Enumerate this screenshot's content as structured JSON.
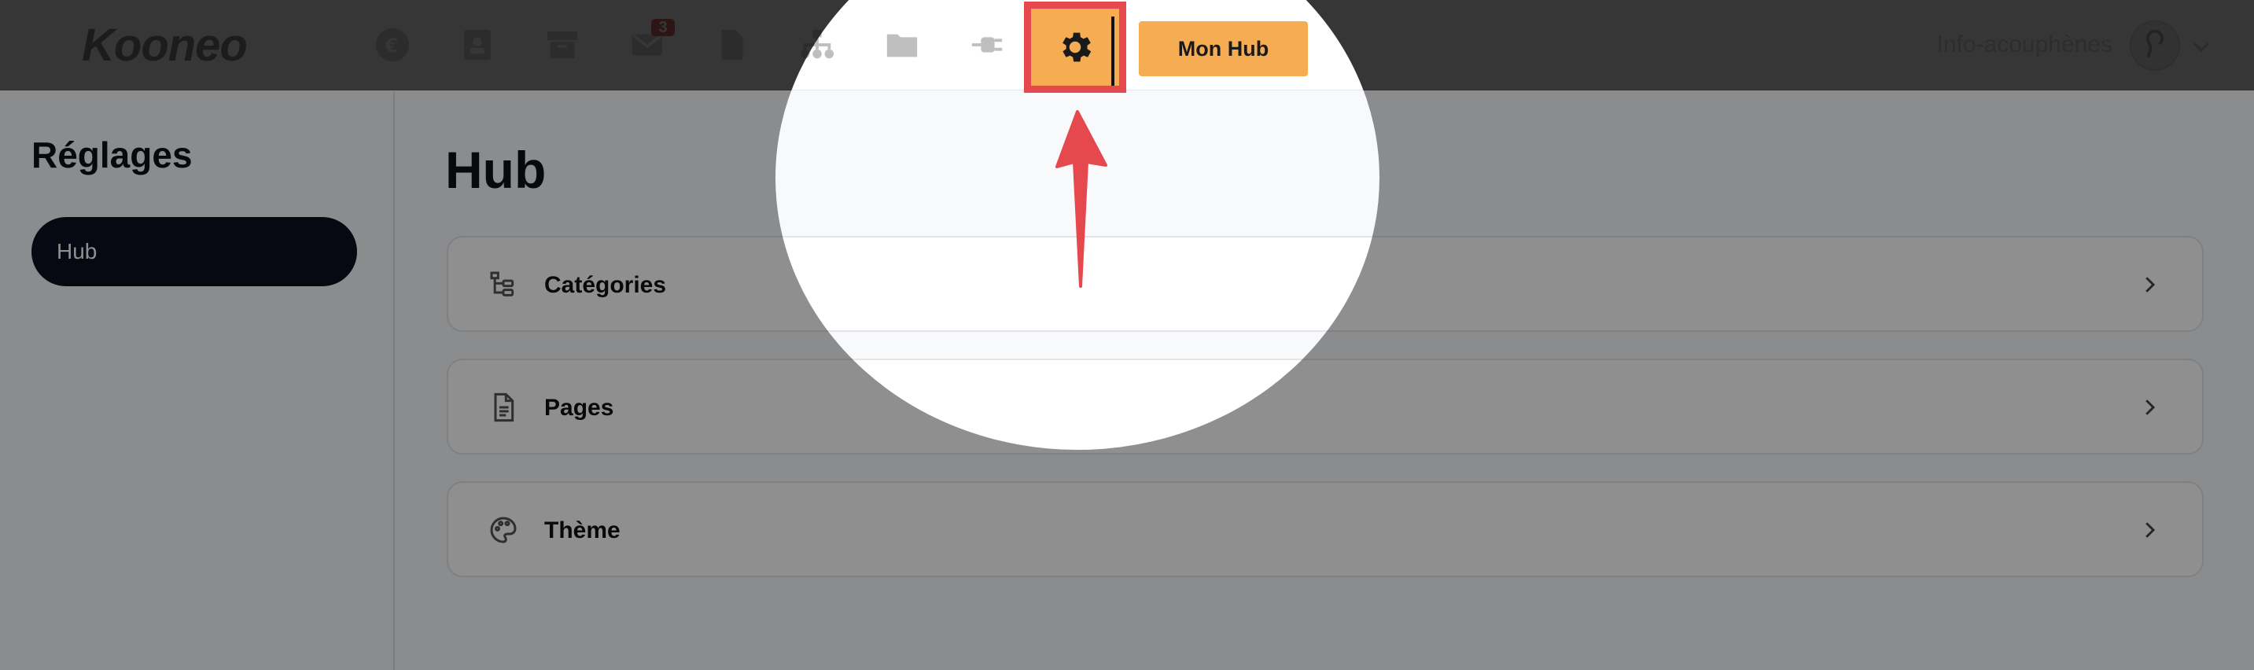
{
  "header": {
    "logo": "Kooneo",
    "notifications_count": "3",
    "hub_button_label": "Mon Hub",
    "user_name": "Info-acouphènes",
    "icons": [
      "euro-icon",
      "contacts-icon",
      "box-icon",
      "mail-icon",
      "file-icon",
      "sitemap-icon",
      "folder-icon",
      "plug-icon",
      "gear-icon"
    ]
  },
  "sidebar": {
    "title": "Réglages",
    "items": [
      {
        "label": "Hub",
        "active": true
      }
    ]
  },
  "main": {
    "title": "Hub",
    "rows": [
      {
        "label": "Catégories",
        "icon": "categories-icon"
      },
      {
        "label": "Pages",
        "icon": "page-icon"
      },
      {
        "label": "Thème",
        "icon": "palette-icon"
      }
    ]
  },
  "colors": {
    "accent": "#f5ac52",
    "highlight": "#e5484d",
    "sidebar_active": "#0b1020"
  }
}
